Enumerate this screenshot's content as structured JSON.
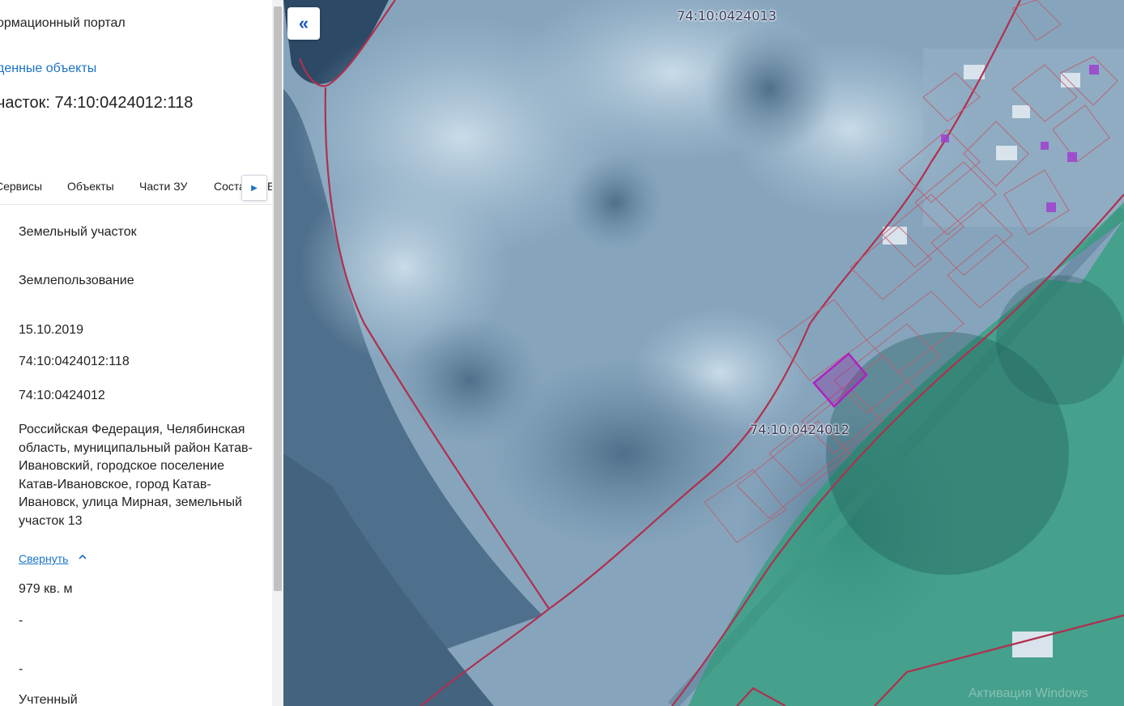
{
  "sidebar": {
    "portal_title": "ормационный портал",
    "found_objects_link": "денные объекты",
    "parcel_heading": "часток: 74:10:0424012:118",
    "tabs": [
      "Сервисы",
      "Объекты",
      "Части ЗУ",
      "Соста",
      "Б"
    ],
    "tab_scroll_icon": "chevron-right-icon",
    "fields": {
      "type": "Земельный участок",
      "category": "Землепользование",
      "date": "15.10.2019",
      "cadastral_number": "74:10:0424012:118",
      "quarter": "74:10:0424012",
      "address": "Российская Федерация, Челябинская область, муниципальный район Катав-Ивановский, городское поселение Катав-Ивановское, город Катав-Ивановск, улица Мирная, земельный участок 13",
      "collapse_link": "Свернуть",
      "area": "979 кв. м",
      "dash1": "-",
      "dash2": "-",
      "status": "Учтенный"
    }
  },
  "map": {
    "back_icon": "double-chevron-left-icon",
    "labels": {
      "quarter_north": "74:10:0424013",
      "quarter_main": "74:10:0424012"
    },
    "watermark": "Активация Windows",
    "colors": {
      "boundary": "#b0304e",
      "selected_parcel": "#b020c0",
      "forest_zone": "#2d9e78"
    }
  }
}
